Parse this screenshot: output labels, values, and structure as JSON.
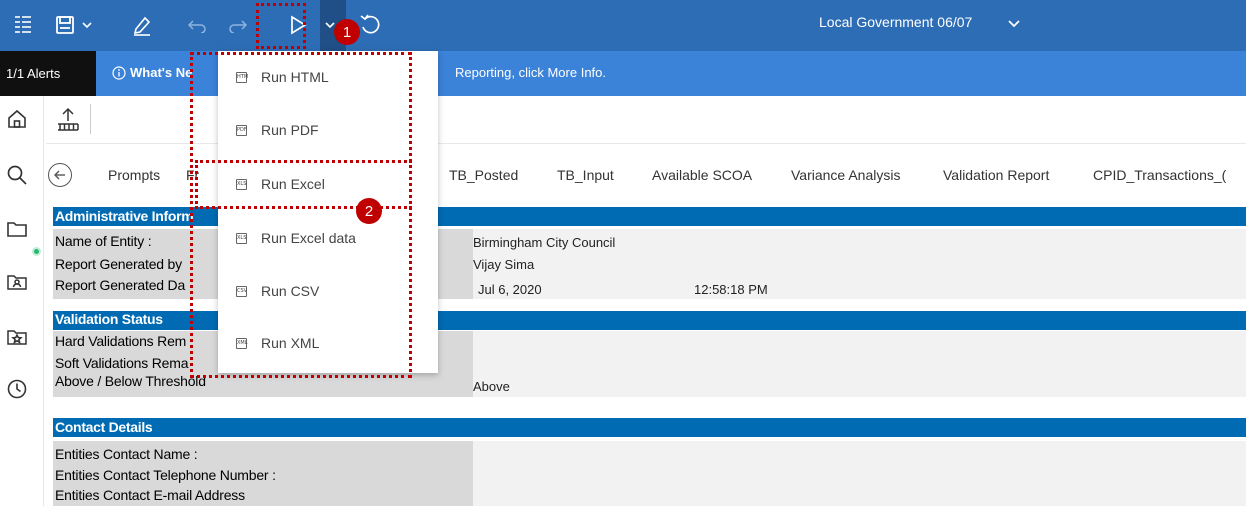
{
  "topbar": {
    "document_title": "Local Government 06/07",
    "icons": [
      "menu-icon",
      "save-icon",
      "chevron-down-icon",
      "edit-icon",
      "undo-icon",
      "redo-icon",
      "run-icon",
      "chevron-down-icon",
      "refresh-icon"
    ]
  },
  "alerts": {
    "count_label": "1/1 Alerts",
    "heading": "What's Ne",
    "message": "Reporting, click More Info."
  },
  "tabs": [
    {
      "label": "Prompts"
    },
    {
      "label": "Fr"
    },
    {
      "label": "TB_Posted"
    },
    {
      "label": "TB_Input"
    },
    {
      "label": "Available SCOA"
    },
    {
      "label": "Variance Analysis"
    },
    {
      "label": "Validation Report"
    },
    {
      "label": "CPID_Transactions_("
    }
  ],
  "run_menu": {
    "items": [
      {
        "label": "Run HTML",
        "file_icon": "HTM"
      },
      {
        "label": "Run PDF",
        "file_icon": "PDF"
      },
      {
        "label": "Run Excel",
        "file_icon": "XLS"
      },
      {
        "label": "Run Excel data",
        "file_icon": "XLS"
      },
      {
        "label": "Run CSV",
        "file_icon": "CSV"
      },
      {
        "label": "Run XML",
        "file_icon": "XML"
      }
    ]
  },
  "report": {
    "admin": {
      "title": "Administrative Inform",
      "rows": [
        {
          "label": "Name of Entity :",
          "value": "Birmingham City Council"
        },
        {
          "label": "Report Generated by",
          "value": "Vijay Sima"
        },
        {
          "label": "Report Generated Da",
          "value": "Jul 6, 2020",
          "value2": "12:58:18 PM"
        }
      ]
    },
    "validation": {
      "title": "Validation Status",
      "rows": [
        {
          "label": "Hard Validations Rem",
          "value": ""
        },
        {
          "label": "Soft Validations Rema",
          "value": ""
        },
        {
          "label": "Above / Below Threshold",
          "value": "Above"
        }
      ]
    },
    "contact": {
      "title": "Contact Details",
      "rows": [
        {
          "label": "Entities Contact Name :"
        },
        {
          "label": "Entities Contact Telephone Number :"
        },
        {
          "label": "Entities Contact E-mail Address"
        }
      ]
    }
  },
  "annotations": {
    "step1": "1",
    "step2": "2",
    "color": "#c00000"
  },
  "colors": {
    "toolbar": "#2d6db5",
    "alert_bar": "#3b82d9",
    "section_header": "#006bb3"
  }
}
